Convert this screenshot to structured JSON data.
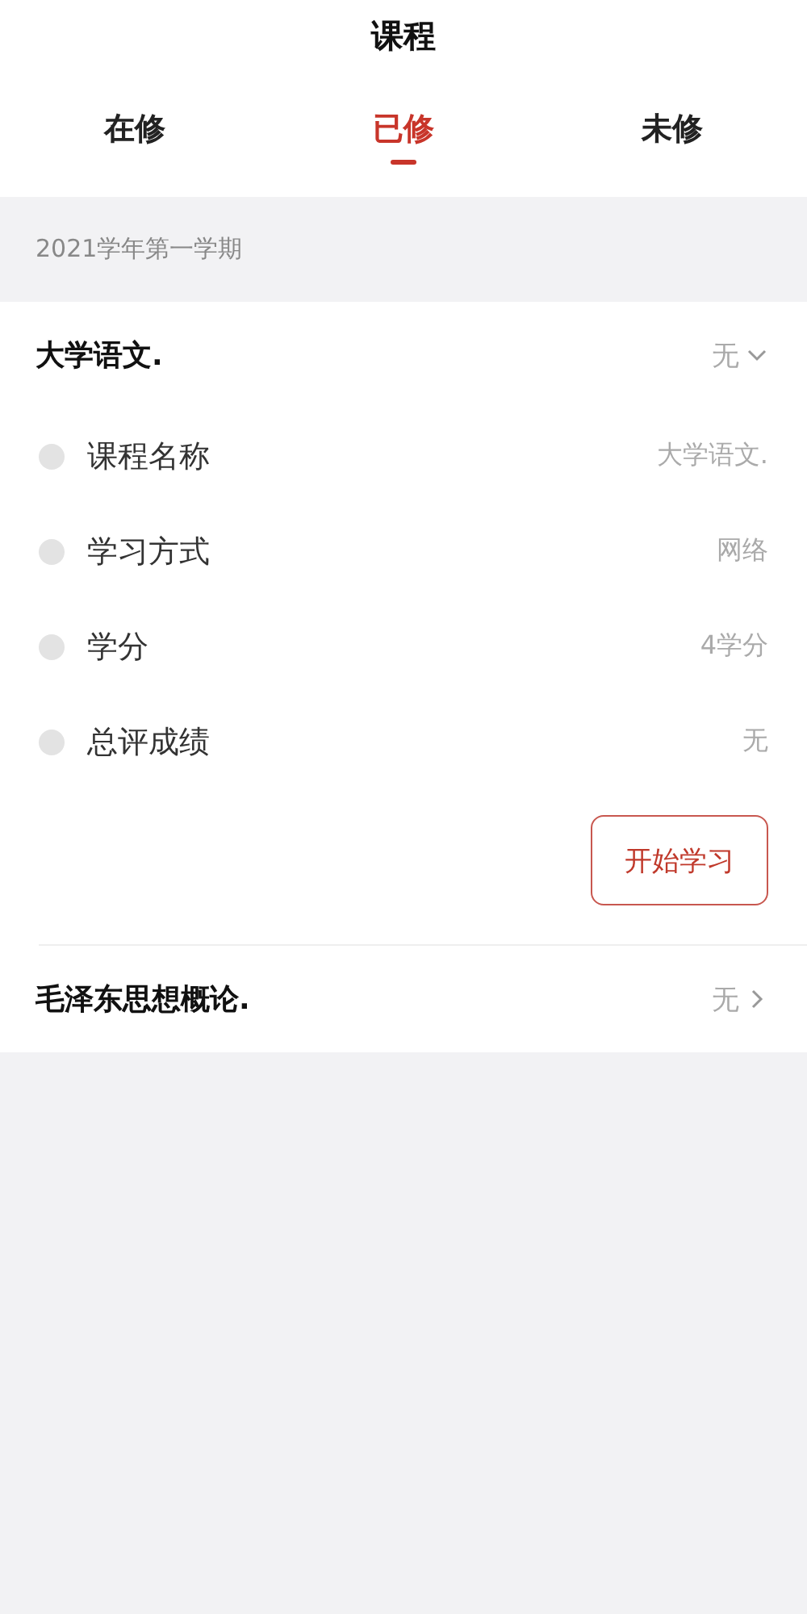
{
  "title": "课程",
  "tabs": [
    {
      "label": "在修",
      "selected": false
    },
    {
      "label": "已修",
      "selected": true
    },
    {
      "label": "未修",
      "selected": false
    }
  ],
  "semester": "2021学年第一学期",
  "courses": [
    {
      "name": "大学语文.",
      "score": "无",
      "expanded": true,
      "fields": [
        {
          "label": "课程名称",
          "value": "大学语文."
        },
        {
          "label": "学习方式",
          "value": "网络"
        },
        {
          "label": "学分",
          "value": "4学分"
        },
        {
          "label": "总评成绩",
          "value": "无"
        }
      ],
      "button": "开始学习"
    },
    {
      "name": "毛泽东思想概论.",
      "score": "无",
      "expanded": false
    }
  ]
}
